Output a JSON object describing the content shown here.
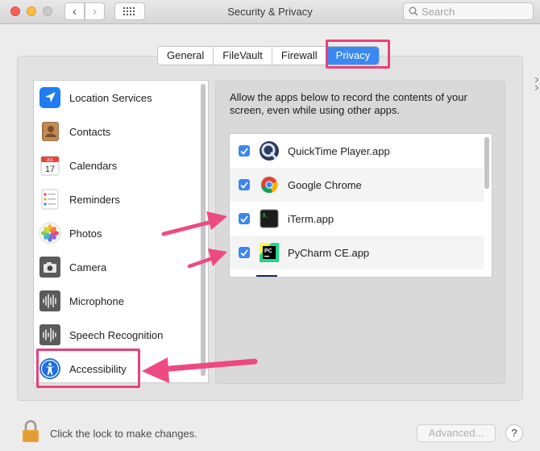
{
  "window": {
    "title": "Security & Privacy",
    "search_placeholder": "Search"
  },
  "tabs": [
    {
      "label": "General"
    },
    {
      "label": "FileVault"
    },
    {
      "label": "Firewall"
    },
    {
      "label": "Privacy",
      "selected": true
    }
  ],
  "sidebar": {
    "items": [
      {
        "label": "Location Services",
        "icon": "location-arrow-icon"
      },
      {
        "label": "Contacts",
        "icon": "contacts-book-icon"
      },
      {
        "label": "Calendars",
        "icon": "calendar-icon",
        "icon_text": "17",
        "icon_month": "JUL"
      },
      {
        "label": "Reminders",
        "icon": "reminders-list-icon"
      },
      {
        "label": "Photos",
        "icon": "photos-flower-icon"
      },
      {
        "label": "Camera",
        "icon": "camera-icon"
      },
      {
        "label": "Microphone",
        "icon": "waveform-icon"
      },
      {
        "label": "Speech Recognition",
        "icon": "waveform-icon"
      },
      {
        "label": "Accessibility",
        "icon": "accessibility-person-icon",
        "highlighted": true
      }
    ]
  },
  "privacy": {
    "description": "Allow the apps below to record the contents of your screen, even while using other apps.",
    "apps": [
      {
        "name": "QuickTime Player.app",
        "checked": true,
        "icon": "quicktime-icon"
      },
      {
        "name": "Google Chrome",
        "checked": true,
        "icon": "chrome-icon"
      },
      {
        "name": "iTerm.app",
        "checked": true,
        "icon": "iterm-icon",
        "icon_text": "$_"
      },
      {
        "name": "PyCharm CE.app",
        "checked": true,
        "icon": "pycharm-icon",
        "icon_text": "PC"
      }
    ]
  },
  "footer": {
    "lock_text": "Click the lock to make changes.",
    "advanced_label": "Advanced...",
    "help_label": "?"
  },
  "colors": {
    "accent": "#3a89f2",
    "annotation": "#e8417a"
  }
}
